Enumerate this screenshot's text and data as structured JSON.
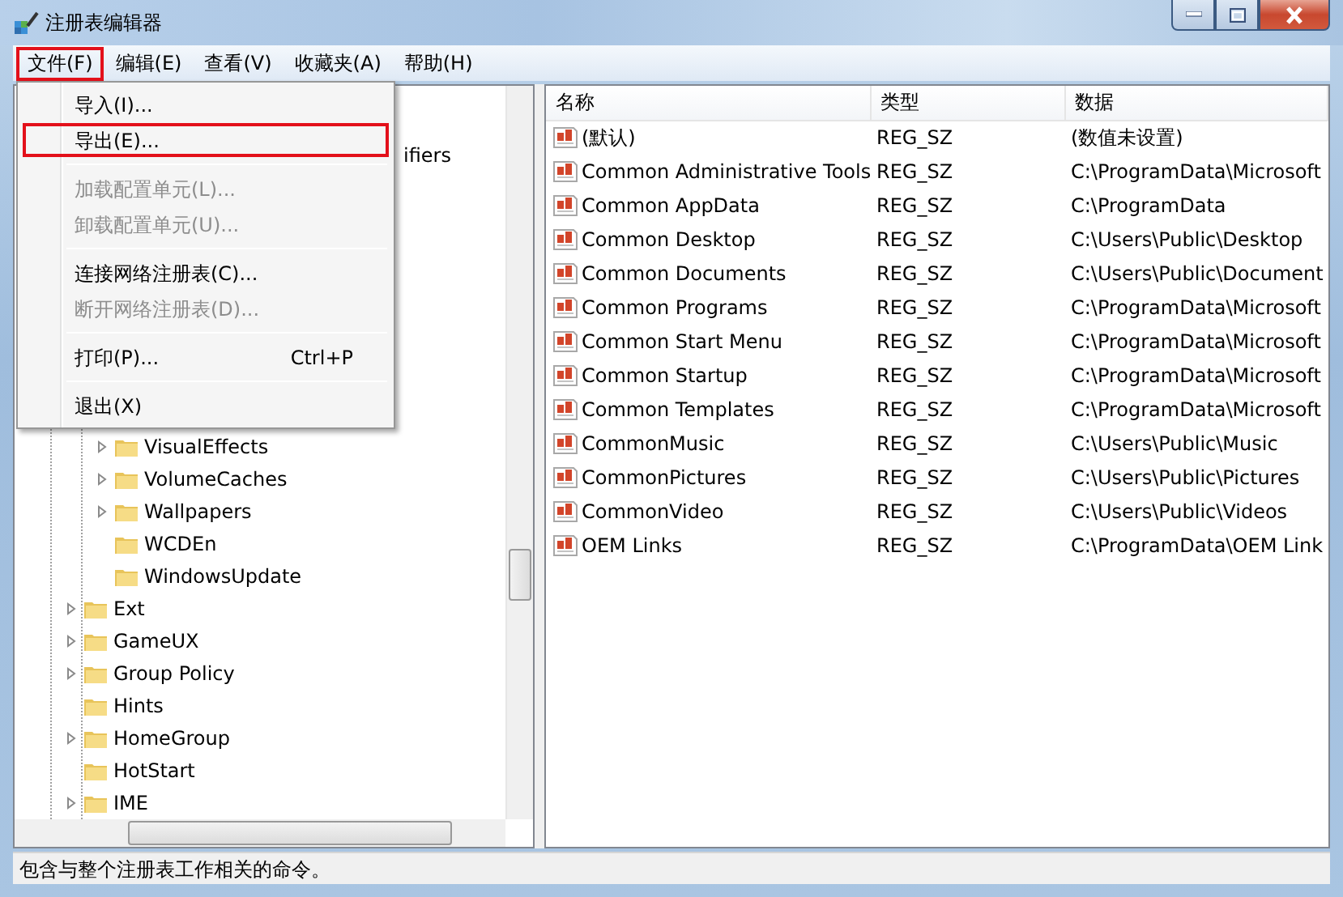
{
  "window": {
    "title": "注册表编辑器"
  },
  "menu_bar": [
    {
      "label": "文件(F)",
      "highlighted": true
    },
    {
      "label": "编辑(E)",
      "highlighted": false
    },
    {
      "label": "查看(V)",
      "highlighted": false
    },
    {
      "label": "收藏夹(A)",
      "highlighted": false
    },
    {
      "label": "帮助(H)",
      "highlighted": false
    }
  ],
  "file_menu": [
    {
      "kind": "item",
      "label": "导入(I)...",
      "disabled": false,
      "highlighted": false
    },
    {
      "kind": "item",
      "label": "导出(E)...",
      "disabled": false,
      "highlighted": true
    },
    {
      "kind": "separator"
    },
    {
      "kind": "item",
      "label": "加载配置单元(L)...",
      "disabled": true,
      "highlighted": false
    },
    {
      "kind": "item",
      "label": "卸载配置单元(U)...",
      "disabled": true,
      "highlighted": false
    },
    {
      "kind": "separator"
    },
    {
      "kind": "item",
      "label": "连接网络注册表(C)...",
      "disabled": false,
      "highlighted": false
    },
    {
      "kind": "item",
      "label": "断开网络注册表(D)...",
      "disabled": true,
      "highlighted": false
    },
    {
      "kind": "separator"
    },
    {
      "kind": "item",
      "label": "打印(P)...",
      "shortcut": "Ctrl+P",
      "disabled": false,
      "highlighted": false
    },
    {
      "kind": "separator"
    },
    {
      "kind": "item",
      "label": "退出(X)",
      "disabled": false,
      "highlighted": false
    }
  ],
  "tree": [
    {
      "children": [
        {
          "label": "ifiers",
          "partial": true
        },
        {
          "kind": "covered"
        },
        {
          "label": "VisualEffects",
          "expandable": true
        },
        {
          "label": "VolumeCaches",
          "expandable": true
        },
        {
          "label": "Wallpapers",
          "expandable": true
        },
        {
          "label": "WCDEn",
          "expandable": false
        },
        {
          "label": "WindowsUpdate",
          "expandable": false
        }
      ]
    },
    {
      "label": "Ext",
      "expandable": true
    },
    {
      "label": "GameUX",
      "expandable": true
    },
    {
      "label": "Group Policy",
      "expandable": true
    },
    {
      "label": "Hints",
      "expandable": false
    },
    {
      "label": "HomeGroup",
      "expandable": true
    },
    {
      "label": "HotStart",
      "expandable": false
    },
    {
      "label": "IME",
      "expandable": true
    }
  ],
  "table": {
    "columns": [
      "名称",
      "类型",
      "数据"
    ],
    "rows": [
      [
        "(默认)",
        "REG_SZ",
        "(数值未设置)"
      ],
      [
        "Common Administrative Tools",
        "REG_SZ",
        "C:\\ProgramData\\Microsoft"
      ],
      [
        "Common AppData",
        "REG_SZ",
        "C:\\ProgramData"
      ],
      [
        "Common Desktop",
        "REG_SZ",
        "C:\\Users\\Public\\Desktop"
      ],
      [
        "Common Documents",
        "REG_SZ",
        "C:\\Users\\Public\\Document"
      ],
      [
        "Common Programs",
        "REG_SZ",
        "C:\\ProgramData\\Microsoft"
      ],
      [
        "Common Start Menu",
        "REG_SZ",
        "C:\\ProgramData\\Microsoft"
      ],
      [
        "Common Startup",
        "REG_SZ",
        "C:\\ProgramData\\Microsoft"
      ],
      [
        "Common Templates",
        "REG_SZ",
        "C:\\ProgramData\\Microsoft"
      ],
      [
        "CommonMusic",
        "REG_SZ",
        "C:\\Users\\Public\\Music"
      ],
      [
        "CommonPictures",
        "REG_SZ",
        "C:\\Users\\Public\\Pictures"
      ],
      [
        "CommonVideo",
        "REG_SZ",
        "C:\\Users\\Public\\Videos"
      ],
      [
        "OEM Links",
        "REG_SZ",
        "C:\\ProgramData\\OEM Link"
      ]
    ]
  },
  "status_bar": "包含与整个注册表工作相关的命令。"
}
